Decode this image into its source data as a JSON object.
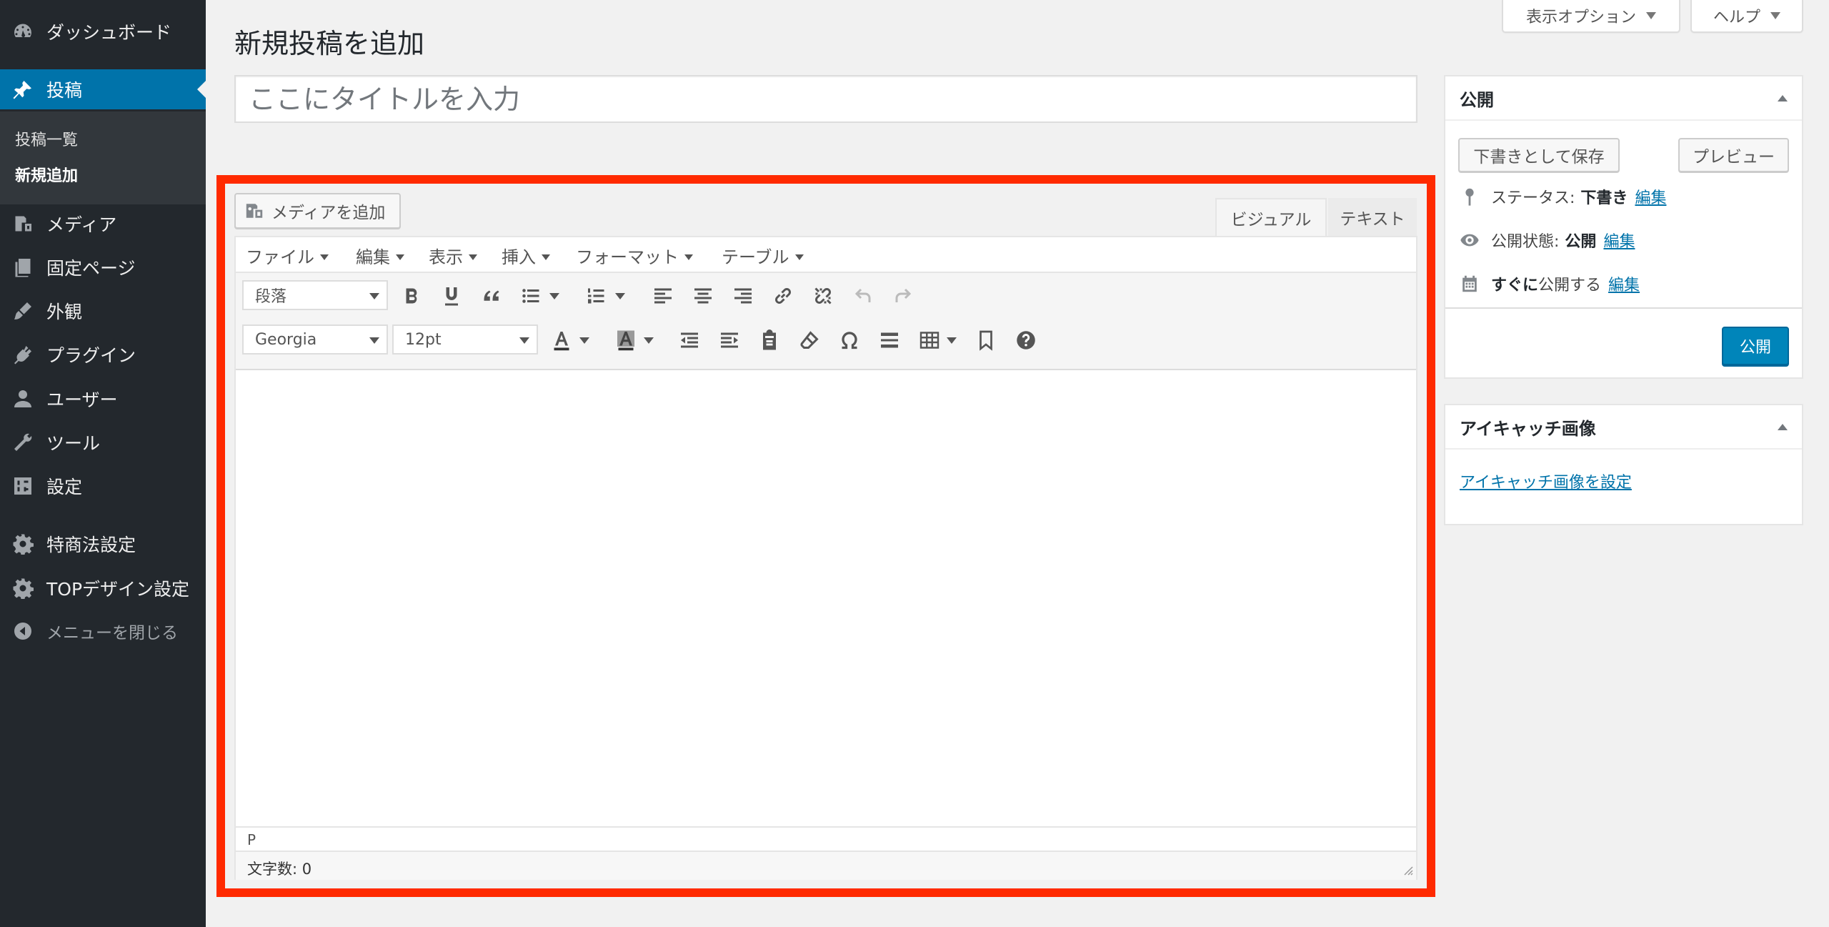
{
  "sidebar": {
    "items": [
      {
        "label": "ダッシュボード",
        "icon": "dashboard-icon"
      },
      {
        "label": "投稿",
        "icon": "pin-icon",
        "active": true
      },
      {
        "label": "メディア",
        "icon": "media-icon"
      },
      {
        "label": "固定ページ",
        "icon": "pages-icon"
      },
      {
        "label": "外観",
        "icon": "appearance-icon"
      },
      {
        "label": "プラグイン",
        "icon": "plugins-icon"
      },
      {
        "label": "ユーザー",
        "icon": "users-icon"
      },
      {
        "label": "ツール",
        "icon": "tools-icon"
      },
      {
        "label": "設定",
        "icon": "settings-icon"
      },
      {
        "label": "特商法設定",
        "icon": "gear-icon"
      },
      {
        "label": "TOPデザイン設定",
        "icon": "gear-icon"
      },
      {
        "label": "メニューを閉じる",
        "icon": "collapse-icon"
      }
    ],
    "submenu": [
      {
        "label": "投稿一覧"
      },
      {
        "label": "新規追加",
        "current": true
      }
    ]
  },
  "screen_meta": {
    "screen_options": "表示オプション",
    "help": "ヘルプ"
  },
  "page": {
    "title": "新規投稿を追加",
    "title_placeholder": "ここにタイトルを入力"
  },
  "editor": {
    "add_media": "メディアを追加",
    "tab_visual": "ビジュアル",
    "tab_text": "テキスト",
    "menubar": [
      "ファイル",
      "編集",
      "表示",
      "挿入",
      "フォーマット",
      "テーブル"
    ],
    "format_select": "段落",
    "font_family": "Georgia",
    "font_size": "12pt",
    "content": "",
    "status_path": "P",
    "word_count_label": "文字数:",
    "word_count": "0"
  },
  "publish_box": {
    "title": "公開",
    "save_draft": "下書きとして保存",
    "preview": "プレビュー",
    "status_label": "ステータス:",
    "status_value": "下書き",
    "visibility_label": "公開状態:",
    "visibility_value": "公開",
    "schedule_strong": "すぐに",
    "schedule_label": "公開する",
    "edit_link": "編集",
    "publish": "公開"
  },
  "featured_image": {
    "title": "アイキャッチ画像",
    "set_link": "アイキャッチ画像を設定"
  },
  "colors": {
    "sidebar_bg": "#23282d",
    "active_blue": "#0073aa",
    "publish_blue": "#0085ba",
    "highlight_red": "#ff2a00"
  }
}
